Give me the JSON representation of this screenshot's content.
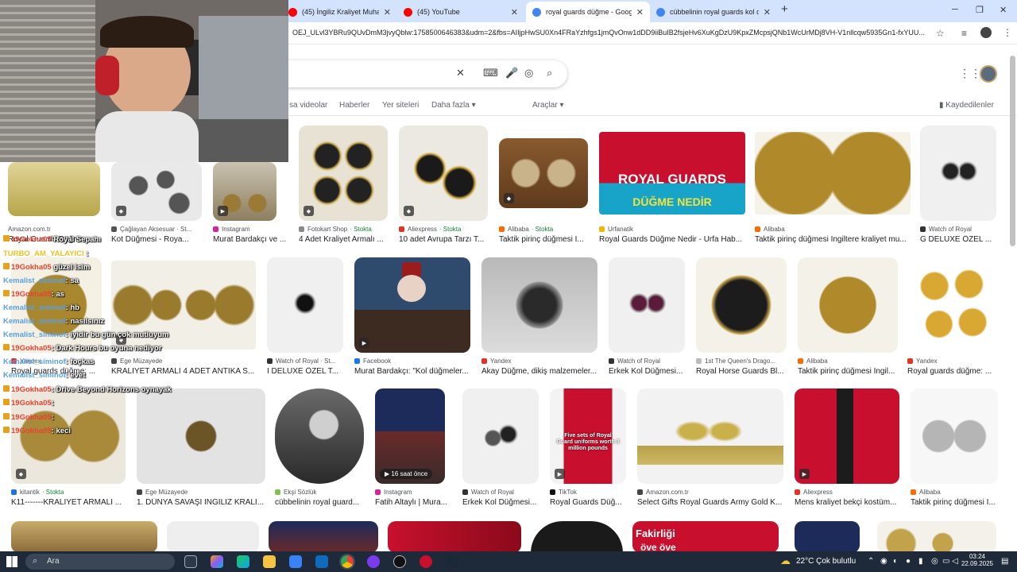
{
  "browser": {
    "tabs": [
      {
        "title": "(45) İngiliz Kraliyet Muhafızı yapılı",
        "active": false,
        "favicon": "youtube-icon"
      },
      {
        "title": "(45) YouTube",
        "active": false,
        "favicon": "youtube-icon"
      },
      {
        "title": "royal guards düğme - Google'da Ara",
        "active": true,
        "favicon": "google-icon"
      },
      {
        "title": "cübbelinin royal guards kol düğmesi",
        "active": false,
        "favicon": "google-icon"
      }
    ],
    "new_tab": "+",
    "url": "OEJ_ULvl3YBRu9QUvDmM3jvyQblw:1758500646383&udm=2&fbs=AIIjpHwSU0Xn4FRaYzhfgs1jmQvOnw1dDD9iiBuIB2fsjeHv6XuKgDzU9KpxZMcpsjQNb1WcUrMDj8VH-V1nllcqw5935Gn1-fxYUU..."
  },
  "search": {
    "filters": [
      "sa videolar",
      "Haberler",
      "Yer siteleri",
      "Daha fazla",
      "Araçlar"
    ],
    "saved": "Kaydedilenler"
  },
  "results": [
    {
      "source": "Amazon.com.tr",
      "title": "Royal Guards Düğme...",
      "stock": ""
    },
    {
      "source": "Çağlayan Aksesuar · St...",
      "title": "Kot Düğmesi - Roya...",
      "stock": ""
    },
    {
      "source": "Instagram",
      "title": "Murat Bardakçı ve ...",
      "stock": ""
    },
    {
      "source": "Fotokart Shop",
      "title": "4 Adet Kraliyet Armalı ...",
      "stock": "Stokta"
    },
    {
      "source": "Aliexpress",
      "title": "10 adet Avrupa Tarzı T...",
      "stock": "Stokta"
    },
    {
      "source": "Alibaba",
      "title": "Taktik pirinç düğmesi İ...",
      "stock": "Stokta"
    },
    {
      "source": "Urfanatik",
      "title": "Royal Guards Düğme Nedir - Urfa Hab...",
      "stock": ""
    },
    {
      "source": "Alibaba",
      "title": "Taktik pirinç düğmesi İngiltere kraliyet mu...",
      "stock": ""
    },
    {
      "source": "Watch of Royal",
      "title": "G DELUXE ÖZEL ...",
      "stock": ""
    },
    {
      "source": "Yandex",
      "title": "Royal guards düğme: ...",
      "stock": ""
    },
    {
      "source": "Ege Müzayede",
      "title": "KRALİYET ARMALI 4 ADET ANTİKA S...",
      "stock": ""
    },
    {
      "source": "Watch of Royal · St...",
      "title": "I DELUXE ÖZEL T...",
      "stock": ""
    },
    {
      "source": "Facebook",
      "title": "Murat Bardakçı: \"Kol düğmeler...",
      "stock": ""
    },
    {
      "source": "Yandex",
      "title": "Akay Düğme, dikiş malzemeler...",
      "stock": ""
    },
    {
      "source": "Watch of Royal",
      "title": "Erkek Kol Düğmesi...",
      "stock": ""
    },
    {
      "source": "1st The Queen's Drago...",
      "title": "Royal Horse Guards Bl...",
      "stock": ""
    },
    {
      "source": "Alibaba",
      "title": "Taktik pirinç düğmesi İngil...",
      "stock": ""
    },
    {
      "source": "Yandex",
      "title": "Royal guards düğme: ...",
      "stock": ""
    },
    {
      "source": "kitantik",
      "title": "K11-------KRALİYET ARMALI ...",
      "stock": "Stokta"
    },
    {
      "source": "Ege Müzayede",
      "title": "1. DÜNYA SAVAŞI İNGİLİZ KRALİ...",
      "stock": ""
    },
    {
      "source": "Ekşi Sözlük",
      "title": "cübbelinin royal guard...",
      "stock": ""
    },
    {
      "source": "Instagram",
      "title": "Fatih Altaylı | Mura...",
      "stock": ""
    },
    {
      "source": "Watch of Royal",
      "title": "Erkek Kol Düğmesi...",
      "stock": ""
    },
    {
      "source": "TikTok",
      "title": "Royal Guards Düğ...",
      "stock": ""
    },
    {
      "source": "Amazon.com.tr",
      "title": "Select Gifts Royal Guards Army Gold K...",
      "stock": ""
    },
    {
      "source": "Aliexpress",
      "title": "Mens kraliyet bekçi kostüm...",
      "stock": ""
    },
    {
      "source": "Alibaba",
      "title": "Taktik pirinç düğmesi İ...",
      "stock": ""
    }
  ],
  "image_texts": {
    "royal_banner_top": "ROYAL GUARDS",
    "royal_banner_bottom": "DÜĞME NEDİR",
    "time_badge": "16 saat önce",
    "tiktok_overlay": "Five sets of Royal Guard uniforms worth 3 million pounds",
    "fakirligi": "Fakirliği",
    "ove": "öve öve"
  },
  "chat": [
    {
      "user": "19Gokha05",
      "text": "Royal Sepahı"
    },
    {
      "user": "TURBO_AM_YALAYICI",
      "text": ":"
    },
    {
      "user": "19Gokha05",
      "text": "güzel isim"
    },
    {
      "user": "Kemalist_siminof",
      "text": ": sa"
    },
    {
      "user": "19Gokha05",
      "text": ": as"
    },
    {
      "user": "Kemalist_siminof",
      "text": ": hb"
    },
    {
      "user": "Kemalist_siminof",
      "text": ": nasılsınız"
    },
    {
      "user": "Kemalist_siminof",
      "text": ": iyidir bu gün çok mutluyum"
    },
    {
      "user": "19Gokha05",
      "text": ": Dark Hours bu oyuna nediyor"
    },
    {
      "user": "Kemalist_siminof",
      "text": ": foçkas"
    },
    {
      "user": "Kemalist_siminof",
      "text": ": evet"
    },
    {
      "user": "19Gokha05",
      "text": ": Drive Beyond Horizons oynayak"
    },
    {
      "user": "19Gokha05",
      "text": ":"
    },
    {
      "user": "19Gokha05",
      "text": ":"
    },
    {
      "user": "19Gokha05",
      "text": ": keci"
    }
  ],
  "taskbar": {
    "search": "Ara",
    "weather": "22°C Çok bulutlu",
    "time": "03:24",
    "date": "22.09.2025"
  }
}
